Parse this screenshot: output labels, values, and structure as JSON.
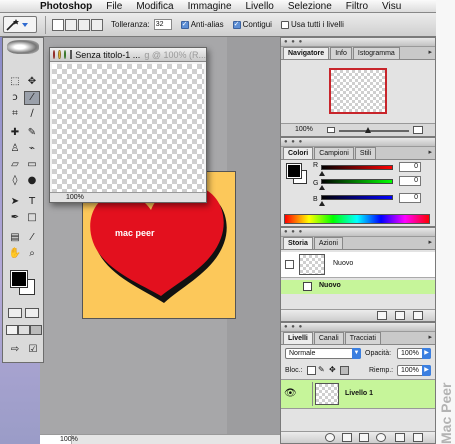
{
  "menubar": {
    "app_name": "Photoshop",
    "items": [
      "File",
      "Modifica",
      "Immagine",
      "Livello",
      "Selezione",
      "Filtro",
      "Visu"
    ]
  },
  "options_bar": {
    "tolerance_label": "Tolleranza:",
    "tolerance_value": "32",
    "antialias_label": "Anti-alias",
    "antialias_checked": true,
    "contiguous_label": "Contigui",
    "contiguous_checked": true,
    "all_layers_label": "Usa tutti i livelli",
    "all_layers_checked": false
  },
  "document": {
    "title": "Senza titolo-1 ...",
    "behind_title": "g @ 100% (R...",
    "zoom": "100%"
  },
  "background_doc": {
    "text": "mac peer",
    "zoom": "100%",
    "colors": {
      "background": "#fcc85a",
      "heart": "#e3101e"
    }
  },
  "navigator_panel": {
    "tabs": [
      "Navigatore",
      "Info",
      "Istogramma"
    ],
    "zoom": "100%"
  },
  "color_panel": {
    "tabs": [
      "Colori",
      "Campioni",
      "Stili"
    ],
    "r_label": "R",
    "g_label": "G",
    "b_label": "B",
    "r_value": "0",
    "g_value": "0",
    "b_value": "0"
  },
  "history_panel": {
    "tabs": [
      "Storia",
      "Azioni"
    ],
    "items": [
      "Nuovo",
      "Nuovo"
    ]
  },
  "layers_panel": {
    "tabs": [
      "Livelli",
      "Canali",
      "Tracciati"
    ],
    "blend_mode": "Normale",
    "opacity_label": "Opacità:",
    "opacity_value": "100%",
    "lock_label": "Bloc.:",
    "fill_label": "Riemp.:",
    "fill_value": "100%",
    "layer_name": "Livello 1"
  },
  "watermark": "Mac Peer"
}
